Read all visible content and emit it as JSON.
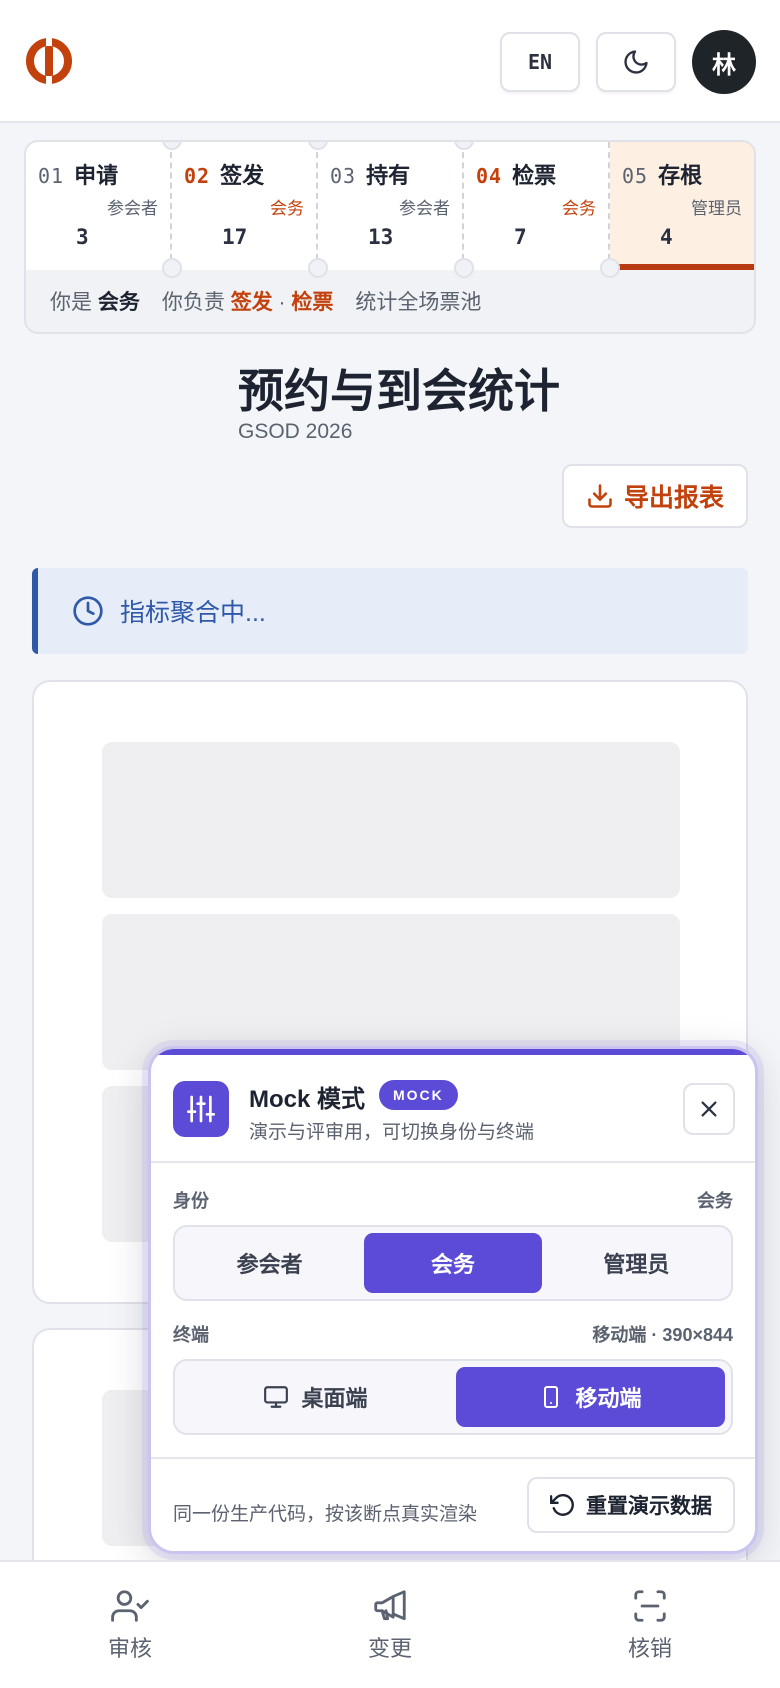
{
  "header": {
    "lang_label": "EN",
    "avatar_text": "林",
    "brand_color": "#c2410c"
  },
  "tickets": {
    "items": [
      {
        "num": "01",
        "name": "申请",
        "role": "参会者",
        "count": "3",
        "highlight": false,
        "active": false
      },
      {
        "num": "02",
        "name": "签发",
        "role": "会务",
        "count": "17",
        "highlight": true,
        "active": false
      },
      {
        "num": "03",
        "name": "持有",
        "role": "参会者",
        "count": "13",
        "highlight": false,
        "active": false
      },
      {
        "num": "04",
        "name": "检票",
        "role": "会务",
        "count": "7",
        "highlight": true,
        "active": false
      },
      {
        "num": "05",
        "name": "存根",
        "role": "管理员",
        "count": "4",
        "highlight": false,
        "active": true
      }
    ],
    "footer": {
      "you_are_prefix": "你是",
      "you_are_role": "会务",
      "responsible_prefix": "你负责",
      "responsible_a": "签发",
      "dot": "·",
      "responsible_b": "检票",
      "scope": "统计全场票池"
    }
  },
  "page": {
    "title": "预约与到会统计",
    "subtitle": "GSOD 2026",
    "export_label": "导出报表"
  },
  "banner": {
    "text": "指标聚合中..."
  },
  "mock": {
    "title": "Mock 模式",
    "badge": "MOCK",
    "subtitle": "演示与评审用，可切换身份与终端",
    "identity_label": "身份",
    "identity_value": "会务",
    "identity_options": [
      "参会者",
      "会务",
      "管理员"
    ],
    "terminal_label": "终端",
    "terminal_value": "移动端 · 390×844",
    "terminal_options": [
      "桌面端",
      "移动端"
    ],
    "note": "同一份生产代码，按该断点真实渲染",
    "reset_label": "重置演示数据",
    "accent_color": "#5b4bd6"
  },
  "bottom_nav": {
    "items": [
      "审核",
      "变更",
      "核销"
    ]
  }
}
